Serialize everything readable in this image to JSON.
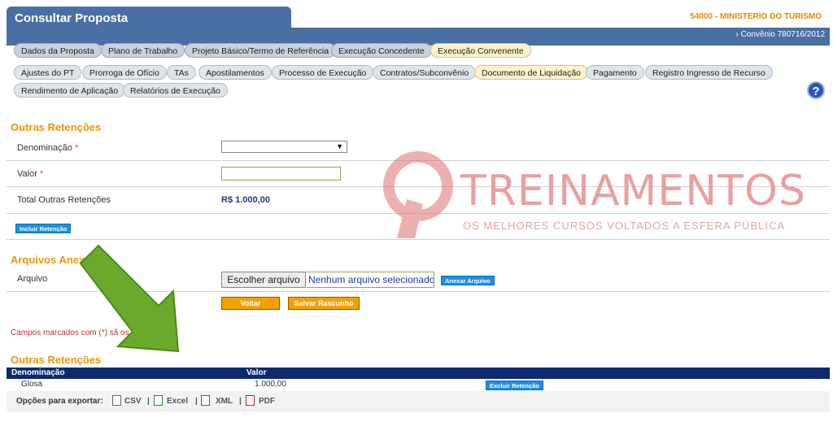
{
  "header": {
    "title": "Consultar Proposta",
    "org": "54000 - MINISTERIO DO TURISMO",
    "convenio": "› Convênio 780716/2012"
  },
  "tabs_main": [
    "Dados da Proposta",
    "Plano de Trabalho",
    "Projeto Básico/Termo de Referência",
    "Execução Concedente",
    "Execução Convenente"
  ],
  "tabs_sub": [
    "Ajustes do PT",
    "Prorroga de Ofício",
    "TAs",
    "Apostilamentos",
    "Processo de Execução",
    "Contratos/Subconvênio",
    "Documento de Liquidação",
    "Pagamento",
    "Registro Ingresso de Recurso",
    "Rendimento de Aplicação",
    "Relatórios de Execução"
  ],
  "help": "?",
  "retencoes_form": {
    "title": "Outras Retenções",
    "denominacao_label": "Denominação",
    "valor_label": "Valor",
    "required_mark": "*",
    "total_label": "Total Outras Retenções",
    "total_value": "R$ 1.000,00",
    "incluir_button": "Incluir Retenção"
  },
  "arquivos": {
    "title": "Arquivos Anex",
    "arquivo_label": "Arquivo",
    "choose_button": "Escolher arquivo",
    "no_file": "Nenhum arquivo selecionado",
    "anexar_button": "Anexar Arquivo",
    "voltar_button": "Voltar",
    "salvar_button": "Salvar Rascunho"
  },
  "campos_note": "Campos marcados com (*) sã                 os",
  "retencoes_table": {
    "title": "Outras Retenções",
    "columns": [
      "Denominação",
      "Valor"
    ],
    "rows": [
      {
        "denominacao": "Glosa",
        "valor": "1.000,00",
        "action": "Excluir Retenção"
      }
    ]
  },
  "export": {
    "label": "Opções para exportar:",
    "csv": "CSV",
    "excel": "Excel",
    "xml": "XML",
    "pdf": "PDF"
  },
  "watermark": {
    "brand": "TREINAMENTOS",
    "tagline": "OS MELHORES CURSOS VOLTADOS A ESFERA PÚBLICA"
  },
  "colors": {
    "header_blue": "#4a6fa5",
    "section_orange": "#f0950a",
    "table_header": "#0c2a6e",
    "arrow_green": "#6aaa2a"
  }
}
